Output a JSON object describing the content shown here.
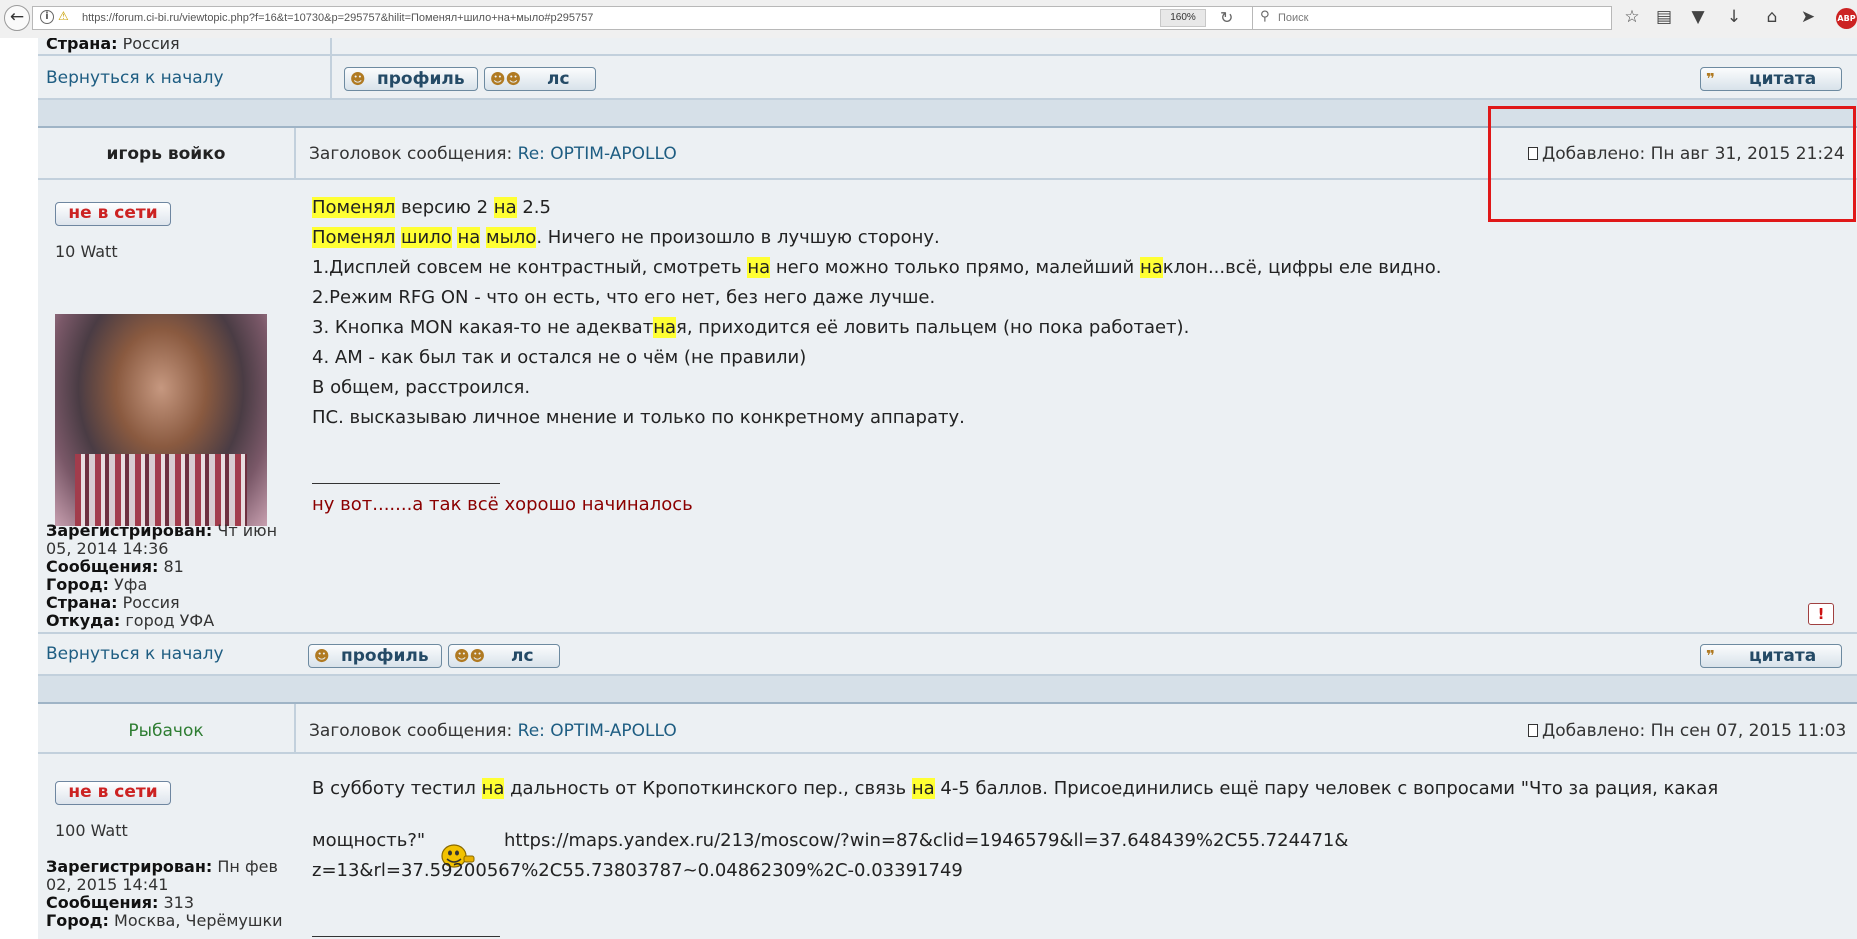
{
  "browser": {
    "url": "https://forum.ci-bi.ru/viewtopic.php?f=16&t=10730&p=295757&hilit=Поменял+шило+на+мыло#p295757",
    "zoom": "160%",
    "search_placeholder": "Поиск",
    "abp_label": "ABP",
    "icons": [
      "back-icon",
      "info-icon",
      "lock-icon",
      "reload-icon",
      "search-icon",
      "star-icon",
      "reader-icon",
      "pocket-icon",
      "download-icon",
      "home-icon",
      "send-icon",
      "abp-icon"
    ]
  },
  "top_post_tail": {
    "country_label": "Страна:",
    "country_value": "Россия",
    "back_to_top": "Вернуться к началу",
    "profile_button": "профиль",
    "pm_button": "лс",
    "quote_button": "цитата"
  },
  "post1": {
    "author": "игорь войко",
    "subject_label": "Заголовок сообщения:",
    "subject": "Re: OPTIM-APOLLO",
    "added_label": "Добавлено:",
    "added_date": "Пн авг 31, 2015 21:24",
    "status": "не в сети",
    "rank": "10 Watt",
    "lines": [
      [
        "Поменял",
        " версию 2 ",
        "на",
        " 2.5"
      ],
      [
        "Поменял",
        " ",
        "шило",
        " ",
        "на",
        " ",
        "мыло",
        ". Ничего не произошло в лучшую сторону."
      ],
      [
        "1.Дисплей совсем не контрастный, смотреть ",
        "на",
        " него можно только прямо, малейший ",
        "на",
        "клон...всё, цифры еле видно."
      ],
      [
        "2.Режим RFG ON - что он есть, что его нет, без него даже лучше."
      ],
      [
        "3. Кнопка MON какая-то не адекват",
        "на",
        "я, приходится её ловить пальцем (но пока работает)."
      ],
      [
        "4. AM - как был так и остался не о чём (не правили)"
      ],
      [
        "В общем, расстроился."
      ],
      [
        "ПС. высказываю личное мнение и только по конкретному аппарату."
      ]
    ],
    "signature": "ну вот.......а так всё хорошо начиналось",
    "registered_label": "Зарегистрирован:",
    "registered_value_1": "Чт июн",
    "registered_value_2": "05, 2014 14:36",
    "posts_label": "Сообщения:",
    "posts_value": "81",
    "city_label": "Город:",
    "city_value": "Уфа",
    "country_label": "Страна:",
    "country_value": "Россия",
    "from_label": "Откуда:",
    "from_value": "город УФА",
    "back_to_top": "Вернуться к началу",
    "profile_button": "профиль",
    "pm_button": "лс",
    "quote_button": "цитата",
    "report_icon": "!"
  },
  "post2": {
    "author": "Рыбачок",
    "subject_label": "Заголовок сообщения:",
    "subject": "Re: OPTIM-APOLLO",
    "added_label": "Добавлено:",
    "added_date": "Пн сен 07, 2015 11:03",
    "status": "не в сети",
    "rank": "100 Watt",
    "line1": [
      "В субботу тестил ",
      "на",
      " дальность от Кропоткинского пер., связь ",
      "на",
      " 4-5 баллов. Присоединились ещё пару человек с вопросами \"Что за рация, какая"
    ],
    "line2": "мощность?\"",
    "link_1": "https://maps.yandex.ru/213/moscow/?win=87&clid=1946579&ll=37.648439%2C55.724471&",
    "link_2": "z=13&rl=37.59200567%2C55.73803787~0.04862309%2C-0.03391749",
    "registered_label": "Зарегистрирован:",
    "registered_value_1": "Пн фев",
    "registered_value_2": "02, 2015 14:41",
    "posts_label": "Сообщения:",
    "posts_value": "313",
    "city_label": "Город:",
    "city_value": "Москва, Черёмушки"
  },
  "colors": {
    "highlight": "#ffff33",
    "link": "#1e5d82",
    "signature": "#8b0000",
    "author2": "#2e7d32",
    "annotation_box": "#e01818"
  }
}
